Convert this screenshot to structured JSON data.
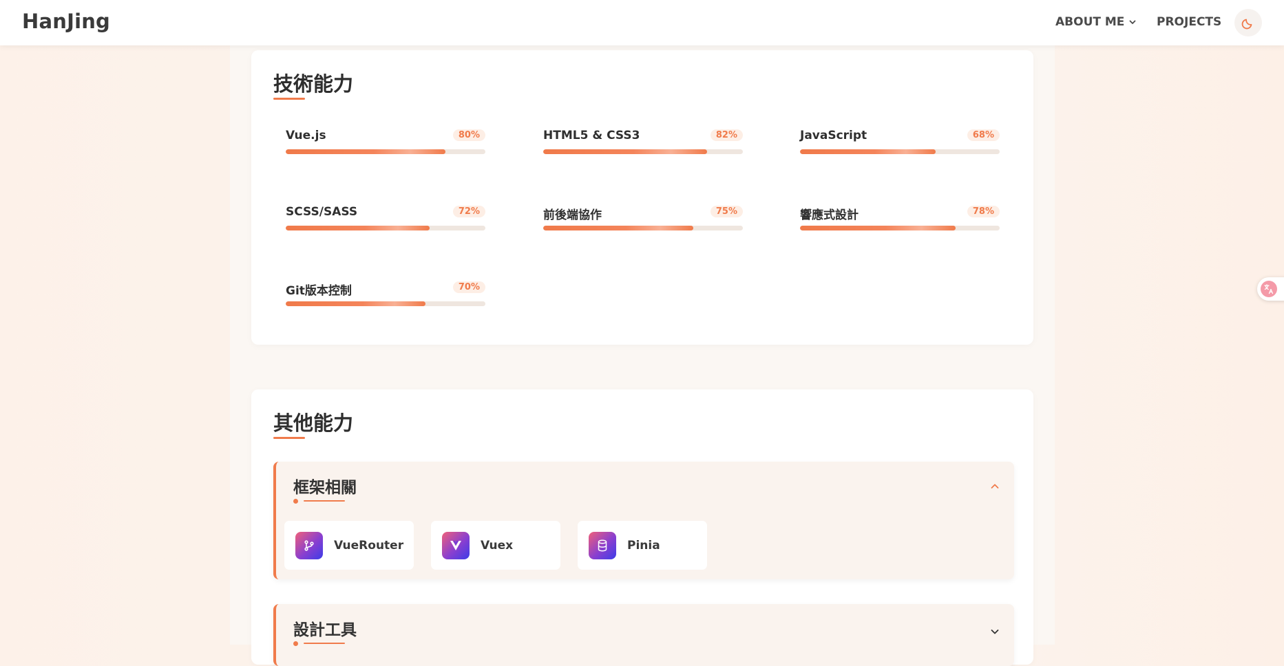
{
  "header": {
    "logo": "HanJing",
    "nav": {
      "about_label": "ABOUT ME",
      "projects_label": "PROJECTS"
    },
    "icons": {
      "about_chevron": "chevron-down-icon",
      "theme": "moon-icon"
    }
  },
  "tech_section": {
    "title": "技術能力",
    "skills": [
      {
        "name": "Vue.js",
        "percent_label": "80%",
        "level": 0.8
      },
      {
        "name": "HTML5 & CSS3",
        "percent_label": "82%",
        "level": 0.82
      },
      {
        "name": "JavaScript",
        "percent_label": "68%",
        "level": 0.68
      },
      {
        "name": "SCSS/SASS",
        "percent_label": "72%",
        "level": 0.72
      },
      {
        "name": "前後端協作",
        "percent_label": "75%",
        "level": 0.75
      },
      {
        "name": "響應式設計",
        "percent_label": "78%",
        "level": 0.78
      },
      {
        "name": "Git版本控制",
        "percent_label": "70%",
        "level": 0.7
      }
    ]
  },
  "other_section": {
    "title": "其他能力",
    "groups": [
      {
        "title": "框架相關",
        "expanded": true,
        "items": [
          {
            "label": "VueRouter",
            "icon": "git-branch-icon"
          },
          {
            "label": "Vuex",
            "icon": "vue-logo-icon"
          },
          {
            "label": "Pinia",
            "icon": "database-icon"
          }
        ]
      },
      {
        "title": "設計工具",
        "expanded": false
      }
    ]
  },
  "floating": {
    "translate_icon": "translate-icon"
  },
  "colors": {
    "accent": "#f07b4b",
    "badge_bg": "#fdeee5",
    "track": "#efe6df",
    "icon_gradient_start": "#f0607a",
    "icon_gradient_end": "#3d3ce8"
  }
}
